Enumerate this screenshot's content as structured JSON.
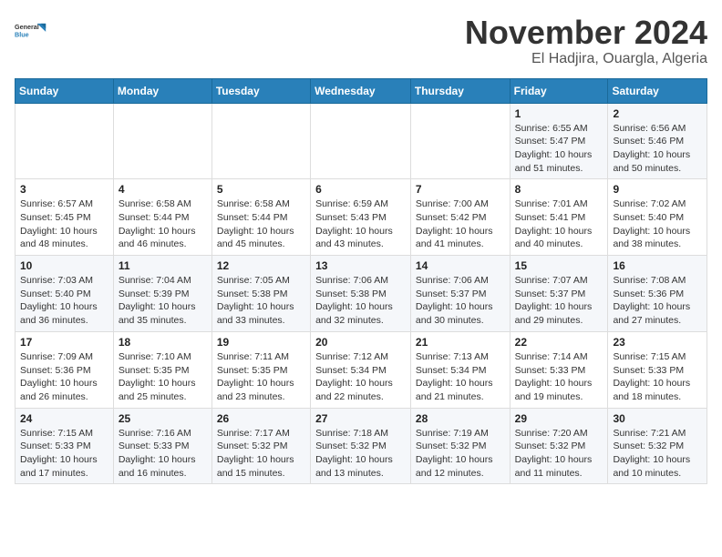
{
  "header": {
    "logo_line1": "General",
    "logo_line2": "Blue",
    "month": "November 2024",
    "location": "El Hadjira, Ouargla, Algeria"
  },
  "weekdays": [
    "Sunday",
    "Monday",
    "Tuesday",
    "Wednesday",
    "Thursday",
    "Friday",
    "Saturday"
  ],
  "weeks": [
    [
      {
        "day": "",
        "info": ""
      },
      {
        "day": "",
        "info": ""
      },
      {
        "day": "",
        "info": ""
      },
      {
        "day": "",
        "info": ""
      },
      {
        "day": "",
        "info": ""
      },
      {
        "day": "1",
        "info": "Sunrise: 6:55 AM\nSunset: 5:47 PM\nDaylight: 10 hours\nand 51 minutes."
      },
      {
        "day": "2",
        "info": "Sunrise: 6:56 AM\nSunset: 5:46 PM\nDaylight: 10 hours\nand 50 minutes."
      }
    ],
    [
      {
        "day": "3",
        "info": "Sunrise: 6:57 AM\nSunset: 5:45 PM\nDaylight: 10 hours\nand 48 minutes."
      },
      {
        "day": "4",
        "info": "Sunrise: 6:58 AM\nSunset: 5:44 PM\nDaylight: 10 hours\nand 46 minutes."
      },
      {
        "day": "5",
        "info": "Sunrise: 6:58 AM\nSunset: 5:44 PM\nDaylight: 10 hours\nand 45 minutes."
      },
      {
        "day": "6",
        "info": "Sunrise: 6:59 AM\nSunset: 5:43 PM\nDaylight: 10 hours\nand 43 minutes."
      },
      {
        "day": "7",
        "info": "Sunrise: 7:00 AM\nSunset: 5:42 PM\nDaylight: 10 hours\nand 41 minutes."
      },
      {
        "day": "8",
        "info": "Sunrise: 7:01 AM\nSunset: 5:41 PM\nDaylight: 10 hours\nand 40 minutes."
      },
      {
        "day": "9",
        "info": "Sunrise: 7:02 AM\nSunset: 5:40 PM\nDaylight: 10 hours\nand 38 minutes."
      }
    ],
    [
      {
        "day": "10",
        "info": "Sunrise: 7:03 AM\nSunset: 5:40 PM\nDaylight: 10 hours\nand 36 minutes."
      },
      {
        "day": "11",
        "info": "Sunrise: 7:04 AM\nSunset: 5:39 PM\nDaylight: 10 hours\nand 35 minutes."
      },
      {
        "day": "12",
        "info": "Sunrise: 7:05 AM\nSunset: 5:38 PM\nDaylight: 10 hours\nand 33 minutes."
      },
      {
        "day": "13",
        "info": "Sunrise: 7:06 AM\nSunset: 5:38 PM\nDaylight: 10 hours\nand 32 minutes."
      },
      {
        "day": "14",
        "info": "Sunrise: 7:06 AM\nSunset: 5:37 PM\nDaylight: 10 hours\nand 30 minutes."
      },
      {
        "day": "15",
        "info": "Sunrise: 7:07 AM\nSunset: 5:37 PM\nDaylight: 10 hours\nand 29 minutes."
      },
      {
        "day": "16",
        "info": "Sunrise: 7:08 AM\nSunset: 5:36 PM\nDaylight: 10 hours\nand 27 minutes."
      }
    ],
    [
      {
        "day": "17",
        "info": "Sunrise: 7:09 AM\nSunset: 5:36 PM\nDaylight: 10 hours\nand 26 minutes."
      },
      {
        "day": "18",
        "info": "Sunrise: 7:10 AM\nSunset: 5:35 PM\nDaylight: 10 hours\nand 25 minutes."
      },
      {
        "day": "19",
        "info": "Sunrise: 7:11 AM\nSunset: 5:35 PM\nDaylight: 10 hours\nand 23 minutes."
      },
      {
        "day": "20",
        "info": "Sunrise: 7:12 AM\nSunset: 5:34 PM\nDaylight: 10 hours\nand 22 minutes."
      },
      {
        "day": "21",
        "info": "Sunrise: 7:13 AM\nSunset: 5:34 PM\nDaylight: 10 hours\nand 21 minutes."
      },
      {
        "day": "22",
        "info": "Sunrise: 7:14 AM\nSunset: 5:33 PM\nDaylight: 10 hours\nand 19 minutes."
      },
      {
        "day": "23",
        "info": "Sunrise: 7:15 AM\nSunset: 5:33 PM\nDaylight: 10 hours\nand 18 minutes."
      }
    ],
    [
      {
        "day": "24",
        "info": "Sunrise: 7:15 AM\nSunset: 5:33 PM\nDaylight: 10 hours\nand 17 minutes."
      },
      {
        "day": "25",
        "info": "Sunrise: 7:16 AM\nSunset: 5:33 PM\nDaylight: 10 hours\nand 16 minutes."
      },
      {
        "day": "26",
        "info": "Sunrise: 7:17 AM\nSunset: 5:32 PM\nDaylight: 10 hours\nand 15 minutes."
      },
      {
        "day": "27",
        "info": "Sunrise: 7:18 AM\nSunset: 5:32 PM\nDaylight: 10 hours\nand 13 minutes."
      },
      {
        "day": "28",
        "info": "Sunrise: 7:19 AM\nSunset: 5:32 PM\nDaylight: 10 hours\nand 12 minutes."
      },
      {
        "day": "29",
        "info": "Sunrise: 7:20 AM\nSunset: 5:32 PM\nDaylight: 10 hours\nand 11 minutes."
      },
      {
        "day": "30",
        "info": "Sunrise: 7:21 AM\nSunset: 5:32 PM\nDaylight: 10 hours\nand 10 minutes."
      }
    ]
  ]
}
